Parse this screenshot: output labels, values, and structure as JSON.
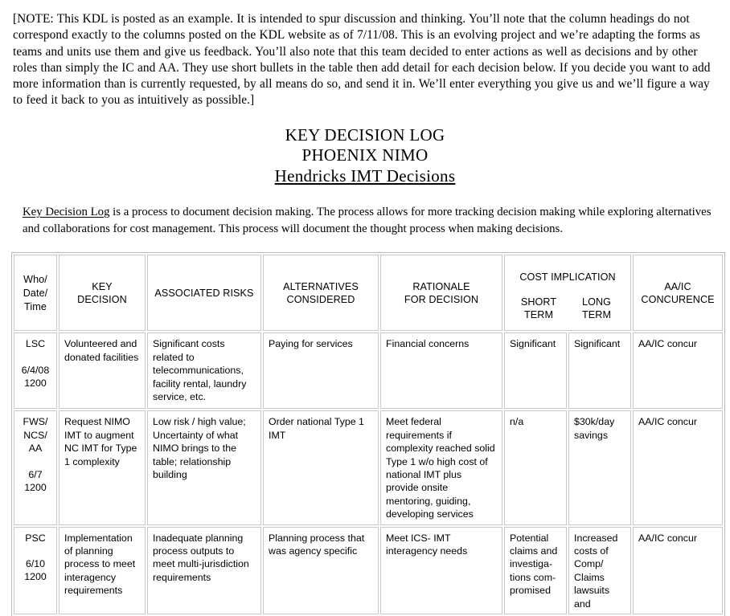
{
  "note": {
    "text": "[NOTE: This KDL is posted as an example.  It is intended to spur discussion and thinking.   You’ll note that the column headings do not correspond exactly to the columns  posted on the KDL  website as of  7/11/08.  This is an evolving project and we’re adapting the forms as teams and units use them and give us feedback.  You’ll also note that this team decided to enter actions as well as decisions and by other roles than simply the IC and AA. They use short bullets in the table then add detail for each decision below. If you decide you want to add more information than is currently requested, by all means  do so, and send it in. We’ll enter everything you give us and we’ll figure a way to feed it back to you as intuitively as possible.]"
  },
  "titles": {
    "line1": "KEY DECISION LOG",
    "line2": "PHOENIX NIMO",
    "line3": "Hendricks IMT Decisions"
  },
  "intro": {
    "lead": "Key Decision Log",
    "rest": " is a process to document decision making. The process allows for more tracking decision making while exploring alternatives and collaborations for cost management. This process will document the thought process when making decisions."
  },
  "table": {
    "headers": {
      "who": "Who/\nDate/\nTime",
      "who_l1": "Who/",
      "who_l2": "Date/",
      "who_l3": "Time",
      "key_decision": "KEY\nDECISION",
      "key_decision_l1": "KEY",
      "key_decision_l2": "DECISION",
      "associated_risks": "ASSOCIATED RISKS",
      "alternatives_l1": "ALTERNATIVES",
      "alternatives_l2": "CONSIDERED",
      "rationale_l1": "RATIONALE",
      "rationale_l2": "FOR DECISION",
      "cost_implication": "COST IMPLICATION",
      "cost_short_l1": "SHORT",
      "cost_short_l2": "TERM",
      "cost_long_l1": "LONG",
      "cost_long_l2": "TERM",
      "aaic_l1": "AA/IC",
      "aaic_l2": "CONCURENCE"
    },
    "rows": [
      {
        "who_name": "LSC",
        "who_date": "6/4/08",
        "who_time": "1200",
        "key_decision": "Volunteered and donated facilities",
        "associated_risks": "Significant costs related to telecommunications, facility rental, laundry service, etc.",
        "alternatives": "Paying for services",
        "rationale": "Financial concerns",
        "cost_short": "Significant",
        "cost_long": "Significant",
        "aaic": "AA/IC concur"
      },
      {
        "who_name": "FWS/\nNCS/\nAA",
        "who_name_l1": "FWS/",
        "who_name_l2": "NCS/",
        "who_name_l3": "AA",
        "who_date": "6/7",
        "who_time": "1200",
        "key_decision": "Request NIMO IMT to augment NC IMT for Type 1 complexity",
        "associated_risks": "Low risk / high value; Uncertainty of what NIMO brings to the table; relationship building",
        "alternatives": "Order national Type 1 IMT",
        "rationale": "Meet federal requirements if complexity reached solid Type 1 w/o high cost of national IMT plus provide onsite mentoring, guiding, developing services",
        "cost_short": "n/a",
        "cost_long": "$30k/day savings",
        "aaic": "AA/IC concur"
      },
      {
        "who_name": "PSC",
        "who_date": "6/10",
        "who_time": "1200",
        "key_decision": "Implementation of planning process to meet interagency requirements",
        "associated_risks": "Inadequate planning process outputs to meet multi-jurisdiction requirements",
        "alternatives": "Planning process that was agency specific",
        "rationale": "Meet ICS- IMT interagency needs",
        "cost_short": "Potential claims and investiga-tions com-promised",
        "cost_long": "Increased costs of Comp/ Claims lawsuits and",
        "aaic": "AA/IC concur"
      }
    ]
  }
}
